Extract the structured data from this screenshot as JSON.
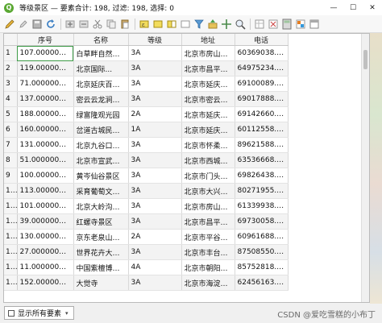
{
  "window": {
    "title": "等级景区 — 要素合计: 198, 过滤: 198, 选择: 0",
    "app_icon": "qgis-logo-icon",
    "controls": {
      "minimize": "—",
      "maximize": "☐",
      "close": "✕"
    }
  },
  "toolbar": {
    "icons": [
      "pencil-edit-icon",
      "multi-edit-icon",
      "save-icon",
      "reload-icon",
      "add-feature-icon",
      "delete-feature-icon",
      "cut-icon",
      "copy-icon",
      "paste-icon",
      "select-expression-icon",
      "select-all-icon",
      "invert-selection-icon",
      "deselect-icon",
      "filter-icon",
      "move-to-top-icon",
      "pan-to-selection-icon",
      "zoom-to-selection-icon",
      "new-field-icon",
      "delete-field-icon",
      "field-calculator-icon",
      "conditional-format-icon",
      "dock-icon"
    ]
  },
  "table": {
    "columns": [
      "序号",
      "名称",
      "等级",
      "地址",
      "电话"
    ],
    "rows": [
      [
        "1",
        "107.000000000...",
        "白草畔自然风...",
        "3A",
        "北京市房山区...",
        "60369038.000..."
      ],
      [
        "2",
        "119.000000000...",
        "北京国际...",
        "3A",
        "北京市昌平区...",
        "64975234.000..."
      ],
      [
        "3",
        "71.000000000...",
        "北京延庆百里...",
        "3A",
        "北京市延庆县...",
        "69100089.000..."
      ],
      [
        "4",
        "137.000000000...",
        "密云云龙涧景区",
        "3A",
        "北京市密云县...",
        "69017888.000..."
      ],
      [
        "5",
        "188.000000000...",
        "绿富隆观光园",
        "2A",
        "北京市延庆县...",
        "69142660.000..."
      ],
      [
        "6",
        "160.000000000...",
        "岔道古城民俗...",
        "1A",
        "北京市延庆县...",
        "60112558.000..."
      ],
      [
        "7",
        "131.000000000...",
        "北京九谷口风...",
        "3A",
        "北京市怀柔区...",
        "89621588.000..."
      ],
      [
        "8",
        "51.000000000...",
        "北京市宣武艺园",
        "3A",
        "北京市西城区...",
        "63536668.000..."
      ],
      [
        "9",
        "100.000000000...",
        "黄岑仙谷景区",
        "3A",
        "北京市门头沟...",
        "69826438.000..."
      ],
      [
        "10",
        "113.000000000...",
        "采育葡萄文化...",
        "3A",
        "北京市大兴区...",
        "80271955.000..."
      ],
      [
        "11",
        "101.000000000...",
        "北京大岭沟猕...",
        "3A",
        "北京市房山区...",
        "61339938.000..."
      ],
      [
        "12",
        "39.000000000...",
        "红螺寺景区",
        "3A",
        "北京市昌平区...",
        "69730058.000..."
      ],
      [
        "13",
        "130.000000000...",
        "京东老泉山野...",
        "2A",
        "北京市平谷区...",
        "60961688.000..."
      ],
      [
        "14",
        "27.000000000...",
        "世界花卉大观园",
        "3A",
        "北京市丰台区...",
        "87508550.000..."
      ],
      [
        "15",
        "11.000000000...",
        "中国紫檀博物馆",
        "4A",
        "北京市朝阳区...",
        "85752818.000..."
      ],
      [
        "16",
        "152.000000000...",
        "大觉寺",
        "3A",
        "北京市海淀区...",
        "62456163.000..."
      ]
    ]
  },
  "status": {
    "filter_label": "显示所有要素",
    "watermark": "CSDN @爱吃雪糕的小布丁"
  }
}
